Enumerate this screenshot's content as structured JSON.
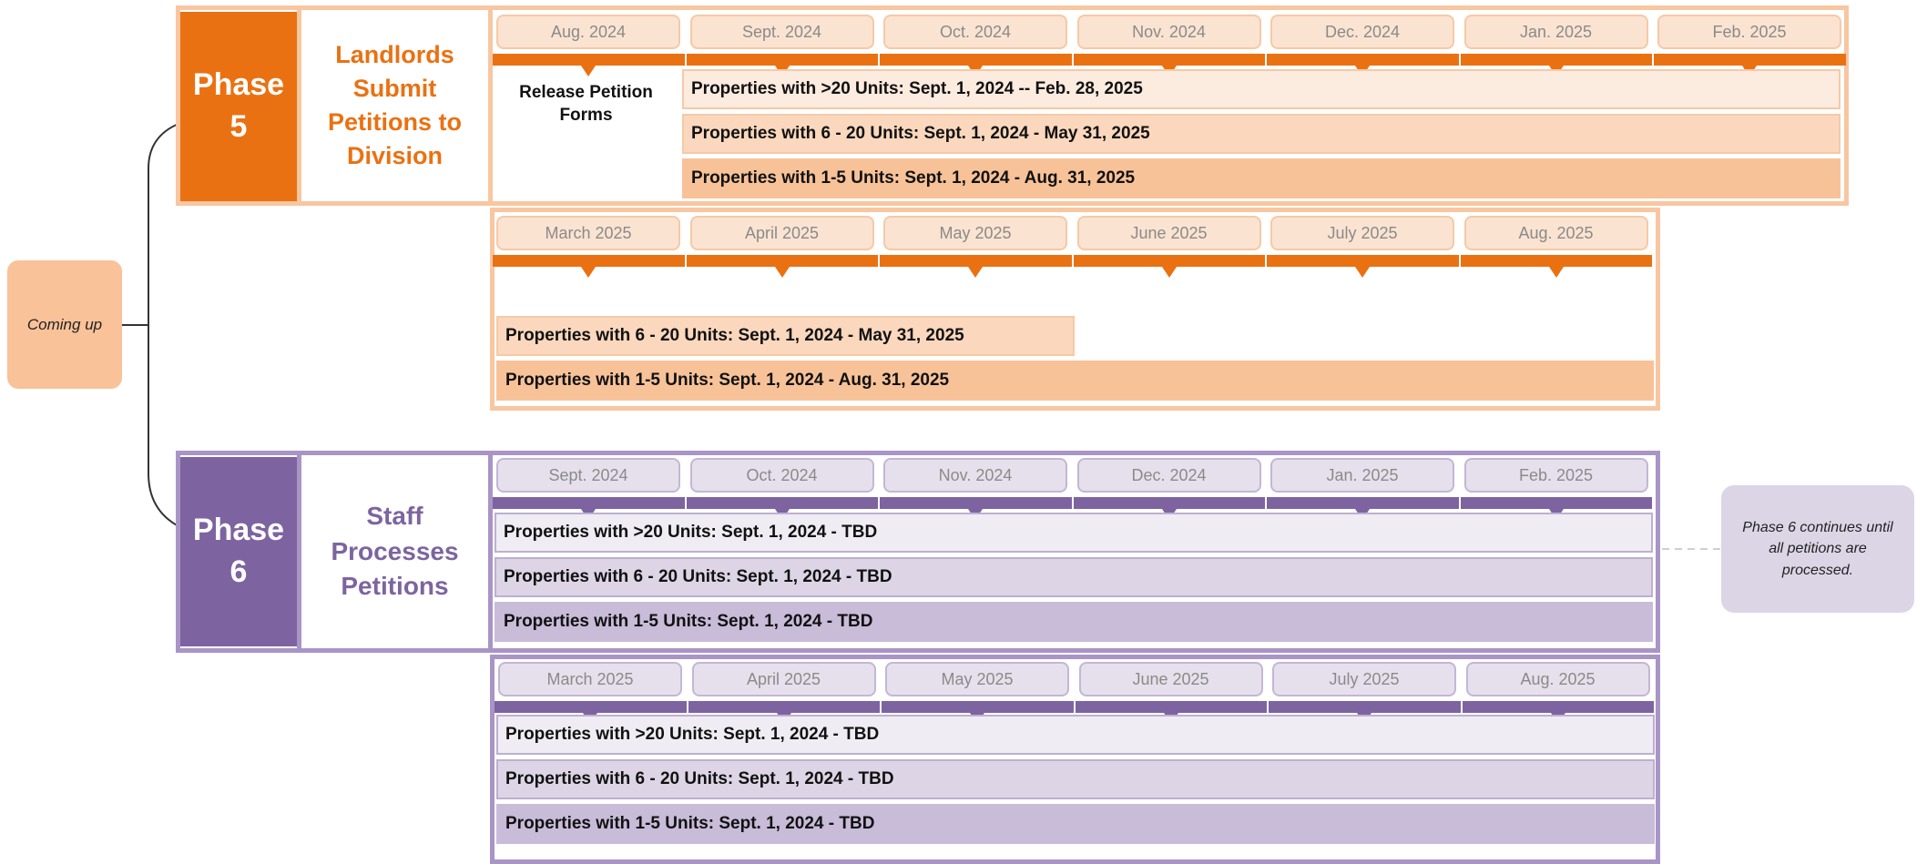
{
  "coming_up": "Coming up",
  "phase5": {
    "label": "Phase 5",
    "description": "Landlords Submit Petitions to Division",
    "release_note": "Release Petition Forms",
    "row1_months": [
      "Aug. 2024",
      "Sept. 2024",
      "Oct. 2024",
      "Nov. 2024",
      "Dec. 2024",
      "Jan. 2025",
      "Feb. 2025"
    ],
    "row1_bars": [
      "Properties with >20 Units: Sept. 1, 2024 -- Feb. 28, 2025",
      "Properties with 6 - 20 Units: Sept. 1, 2024 - May 31, 2025",
      "Properties with 1-5 Units: Sept. 1, 2024 - Aug. 31, 2025"
    ],
    "row2_months": [
      "March 2025",
      "April 2025",
      "May 2025",
      "June 2025",
      "July 2025",
      "Aug. 2025"
    ],
    "row2_bars": [
      "Properties with 6 - 20 Units: Sept. 1, 2024 - May 31, 2025",
      "Properties with 1-5 Units: Sept. 1, 2024 - Aug. 31, 2025"
    ]
  },
  "phase6": {
    "label": "Phase 6",
    "description": "Staff Processes Petitions",
    "row1_months": [
      "Sept. 2024",
      "Oct. 2024",
      "Nov. 2024",
      "Dec. 2024",
      "Jan. 2025",
      "Feb. 2025"
    ],
    "row1_bars": [
      "Properties with >20 Units: Sept. 1, 2024 - TBD",
      "Properties with 6 - 20 Units: Sept. 1, 2024 - TBD",
      "Properties with 1-5 Units: Sept. 1, 2024 - TBD"
    ],
    "row2_months": [
      "March 2025",
      "April 2025",
      "May 2025",
      "June 2025",
      "July 2025",
      "Aug. 2025"
    ],
    "row2_bars": [
      "Properties with >20 Units: Sept. 1, 2024 - TBD",
      "Properties with 6 - 20 Units: Sept. 1, 2024 - TBD",
      "Properties with 1-5 Units: Sept. 1, 2024 - TBD"
    ],
    "note": "Phase 6 continues until all petitions are processed."
  },
  "colors": {
    "orange": "#ea7112",
    "orange_light": "#f8c6a0",
    "purple": "#7d64a0",
    "purple_light": "#a994c6"
  }
}
